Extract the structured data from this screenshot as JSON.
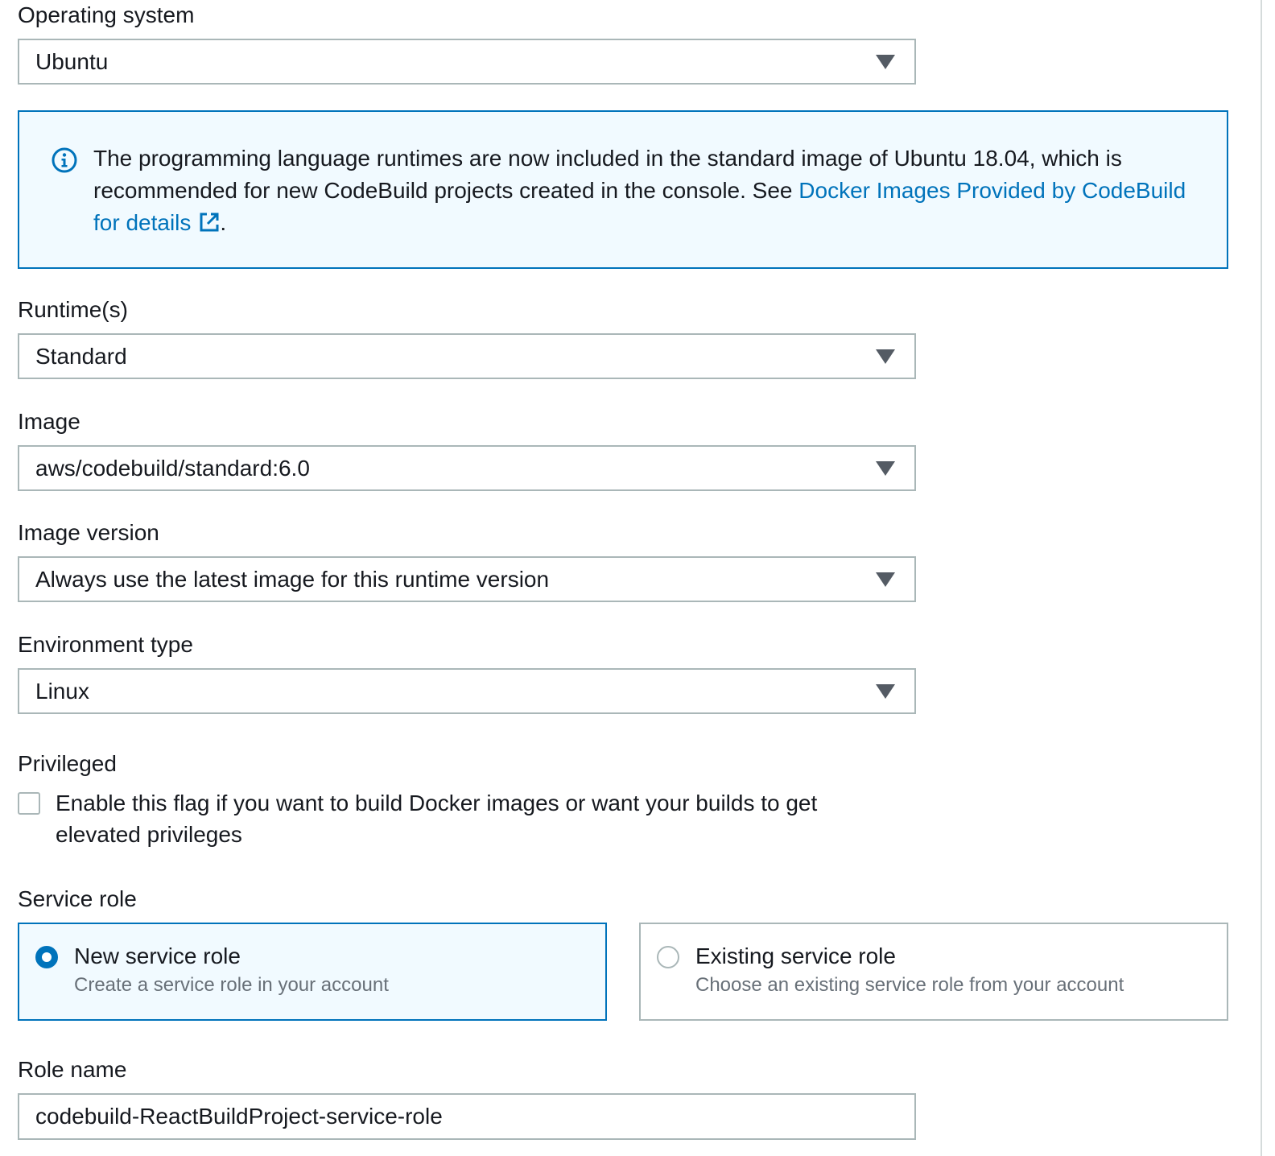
{
  "operating_system": {
    "label": "Operating system",
    "value": "Ubuntu"
  },
  "info_alert": {
    "text": "The programming language runtimes are now included in the standard image of Ubuntu 18.04, which is recommended for new CodeBuild projects created in the console. See ",
    "link_text": "Docker Images Provided by CodeBuild for details",
    "suffix": ".",
    "icon": "info-icon",
    "link_icon": "external-link-icon"
  },
  "runtimes": {
    "label": "Runtime(s)",
    "value": "Standard"
  },
  "image": {
    "label": "Image",
    "value": "aws/codebuild/standard:6.0"
  },
  "image_version": {
    "label": "Image version",
    "value": "Always use the latest image for this runtime version"
  },
  "environment_type": {
    "label": "Environment type",
    "value": "Linux"
  },
  "privileged": {
    "label": "Privileged",
    "checkbox_label": "Enable this flag if you want to build Docker images or want your builds to get elevated privileges",
    "checked": false
  },
  "service_role": {
    "label": "Service role",
    "options": [
      {
        "title": "New service role",
        "description": "Create a service role in your account",
        "selected": true
      },
      {
        "title": "Existing service role",
        "description": "Choose an existing service role from your account",
        "selected": false
      }
    ]
  },
  "role_name": {
    "label": "Role name",
    "value": "codebuild-ReactBuildProject-service-role"
  },
  "colors": {
    "accent": "#0073bb",
    "border": "#aab7b8",
    "info_bg": "#f1faff",
    "muted_text": "#687078"
  }
}
